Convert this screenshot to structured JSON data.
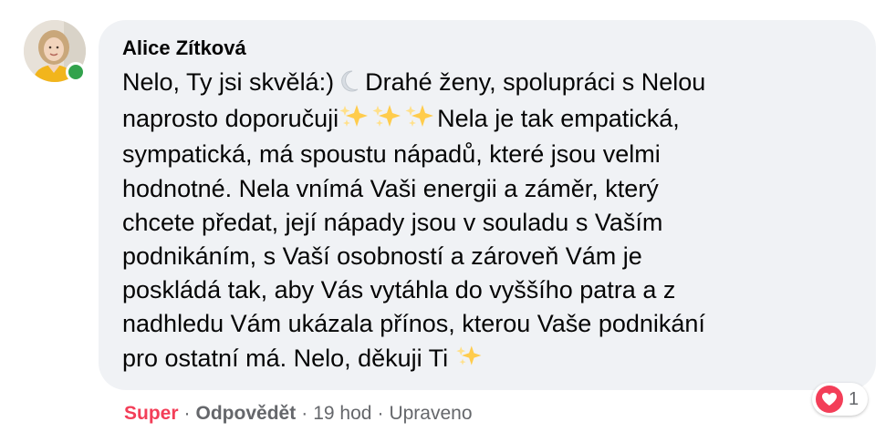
{
  "comment": {
    "author": "Alice Zítková",
    "lines": [
      [
        "Nelo, Ty jsi skvělá:)",
        "{moon}",
        "Drahé ženy, spolupráci s Nelou"
      ],
      [
        "naprosto doporučuji",
        "{sparkles}",
        "{sparkles}",
        "{sparkles}",
        "Nela je tak empatická,"
      ],
      [
        "sympatická, má spoustu nápadů, které jsou velmi"
      ],
      [
        "hodnotné. Nela vnímá Vaši energii a záměr, který"
      ],
      [
        "chcete předat, její nápady jsou v souladu s Vaším"
      ],
      [
        "podnikáním, s Vaší osobností a zároveň Vám je"
      ],
      [
        "poskládá tak, aby Vás vytáhla do vyššího patra a z"
      ],
      [
        "nadhledu Vám ukázala přínos, kterou Vaše podnikání"
      ],
      [
        "pro ostatní má. Nelo, děkuji Ti",
        "{sparkles}"
      ]
    ],
    "line_texts": {
      "l1a": "Nelo, Ty jsi skvělá:)",
      "l1b": "Drahé ženy, spolupráci s Nelou",
      "l2a": "naprosto doporučuji",
      "l2b": "Nela je tak empatická,",
      "l3": "sympatická, má spoustu nápadů, které jsou velmi",
      "l4": "hodnotné. Nela vnímá Vaši energii a záměr, který",
      "l5": "chcete předat, její nápady jsou v souladu s Vaším",
      "l6": "podnikáním, s Vaší osobností a zároveň Vám je",
      "l7": "poskládá tak, aby Vás vytáhla do vyššího patra a z",
      "l8": "nadhledu Vám ukázala přínos, kterou Vaše podnikání",
      "l9": "pro ostatní má. Nelo, děkuji Ti"
    },
    "icons": {
      "moon": "crescent-moon-icon",
      "sparkles": "sparkles-icon",
      "heart": "heart-icon"
    },
    "author_online": true
  },
  "reactions": {
    "count": "1",
    "type": "heart"
  },
  "actions": {
    "react_label": "Super",
    "reply_label": "Odpovědět",
    "separator": "·",
    "time": "19 hod",
    "edited_label": "Upraveno"
  },
  "colors": {
    "bubble_bg": "#f0f2f5",
    "text": "#050505",
    "secondary_text": "#65676b",
    "reaction_red": "#f33e58",
    "online_green": "#31a24c",
    "sparkle_yellow": "#ffcc4d"
  }
}
